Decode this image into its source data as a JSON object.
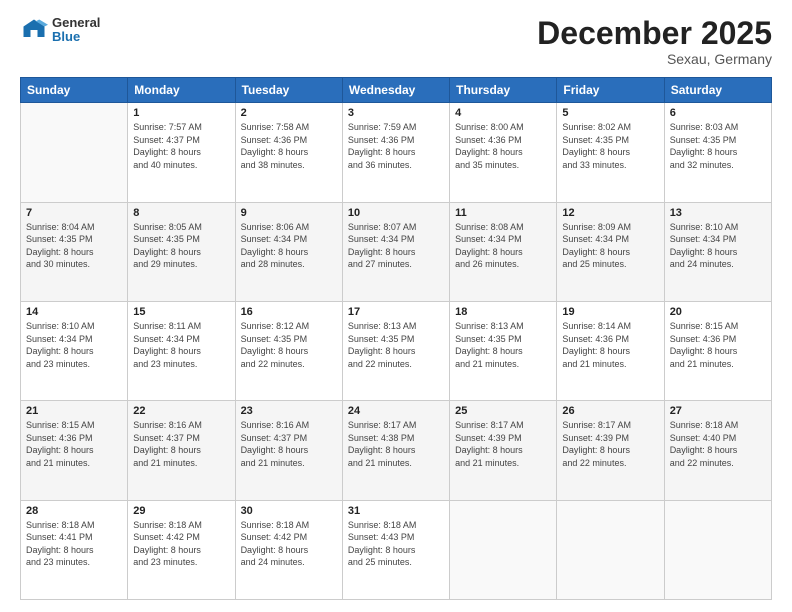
{
  "header": {
    "logo": {
      "general": "General",
      "blue": "Blue"
    },
    "title": "December 2025",
    "location": "Sexau, Germany"
  },
  "calendar": {
    "days_of_week": [
      "Sunday",
      "Monday",
      "Tuesday",
      "Wednesday",
      "Thursday",
      "Friday",
      "Saturday"
    ],
    "weeks": [
      [
        {
          "day": "",
          "info": ""
        },
        {
          "day": "1",
          "info": "Sunrise: 7:57 AM\nSunset: 4:37 PM\nDaylight: 8 hours\nand 40 minutes."
        },
        {
          "day": "2",
          "info": "Sunrise: 7:58 AM\nSunset: 4:36 PM\nDaylight: 8 hours\nand 38 minutes."
        },
        {
          "day": "3",
          "info": "Sunrise: 7:59 AM\nSunset: 4:36 PM\nDaylight: 8 hours\nand 36 minutes."
        },
        {
          "day": "4",
          "info": "Sunrise: 8:00 AM\nSunset: 4:36 PM\nDaylight: 8 hours\nand 35 minutes."
        },
        {
          "day": "5",
          "info": "Sunrise: 8:02 AM\nSunset: 4:35 PM\nDaylight: 8 hours\nand 33 minutes."
        },
        {
          "day": "6",
          "info": "Sunrise: 8:03 AM\nSunset: 4:35 PM\nDaylight: 8 hours\nand 32 minutes."
        }
      ],
      [
        {
          "day": "7",
          "info": "Sunrise: 8:04 AM\nSunset: 4:35 PM\nDaylight: 8 hours\nand 30 minutes."
        },
        {
          "day": "8",
          "info": "Sunrise: 8:05 AM\nSunset: 4:35 PM\nDaylight: 8 hours\nand 29 minutes."
        },
        {
          "day": "9",
          "info": "Sunrise: 8:06 AM\nSunset: 4:34 PM\nDaylight: 8 hours\nand 28 minutes."
        },
        {
          "day": "10",
          "info": "Sunrise: 8:07 AM\nSunset: 4:34 PM\nDaylight: 8 hours\nand 27 minutes."
        },
        {
          "day": "11",
          "info": "Sunrise: 8:08 AM\nSunset: 4:34 PM\nDaylight: 8 hours\nand 26 minutes."
        },
        {
          "day": "12",
          "info": "Sunrise: 8:09 AM\nSunset: 4:34 PM\nDaylight: 8 hours\nand 25 minutes."
        },
        {
          "day": "13",
          "info": "Sunrise: 8:10 AM\nSunset: 4:34 PM\nDaylight: 8 hours\nand 24 minutes."
        }
      ],
      [
        {
          "day": "14",
          "info": "Sunrise: 8:10 AM\nSunset: 4:34 PM\nDaylight: 8 hours\nand 23 minutes."
        },
        {
          "day": "15",
          "info": "Sunrise: 8:11 AM\nSunset: 4:34 PM\nDaylight: 8 hours\nand 23 minutes."
        },
        {
          "day": "16",
          "info": "Sunrise: 8:12 AM\nSunset: 4:35 PM\nDaylight: 8 hours\nand 22 minutes."
        },
        {
          "day": "17",
          "info": "Sunrise: 8:13 AM\nSunset: 4:35 PM\nDaylight: 8 hours\nand 22 minutes."
        },
        {
          "day": "18",
          "info": "Sunrise: 8:13 AM\nSunset: 4:35 PM\nDaylight: 8 hours\nand 21 minutes."
        },
        {
          "day": "19",
          "info": "Sunrise: 8:14 AM\nSunset: 4:36 PM\nDaylight: 8 hours\nand 21 minutes."
        },
        {
          "day": "20",
          "info": "Sunrise: 8:15 AM\nSunset: 4:36 PM\nDaylight: 8 hours\nand 21 minutes."
        }
      ],
      [
        {
          "day": "21",
          "info": "Sunrise: 8:15 AM\nSunset: 4:36 PM\nDaylight: 8 hours\nand 21 minutes."
        },
        {
          "day": "22",
          "info": "Sunrise: 8:16 AM\nSunset: 4:37 PM\nDaylight: 8 hours\nand 21 minutes."
        },
        {
          "day": "23",
          "info": "Sunrise: 8:16 AM\nSunset: 4:37 PM\nDaylight: 8 hours\nand 21 minutes."
        },
        {
          "day": "24",
          "info": "Sunrise: 8:17 AM\nSunset: 4:38 PM\nDaylight: 8 hours\nand 21 minutes."
        },
        {
          "day": "25",
          "info": "Sunrise: 8:17 AM\nSunset: 4:39 PM\nDaylight: 8 hours\nand 21 minutes."
        },
        {
          "day": "26",
          "info": "Sunrise: 8:17 AM\nSunset: 4:39 PM\nDaylight: 8 hours\nand 22 minutes."
        },
        {
          "day": "27",
          "info": "Sunrise: 8:18 AM\nSunset: 4:40 PM\nDaylight: 8 hours\nand 22 minutes."
        }
      ],
      [
        {
          "day": "28",
          "info": "Sunrise: 8:18 AM\nSunset: 4:41 PM\nDaylight: 8 hours\nand 23 minutes."
        },
        {
          "day": "29",
          "info": "Sunrise: 8:18 AM\nSunset: 4:42 PM\nDaylight: 8 hours\nand 23 minutes."
        },
        {
          "day": "30",
          "info": "Sunrise: 8:18 AM\nSunset: 4:42 PM\nDaylight: 8 hours\nand 24 minutes."
        },
        {
          "day": "31",
          "info": "Sunrise: 8:18 AM\nSunset: 4:43 PM\nDaylight: 8 hours\nand 25 minutes."
        },
        {
          "day": "",
          "info": ""
        },
        {
          "day": "",
          "info": ""
        },
        {
          "day": "",
          "info": ""
        }
      ]
    ]
  }
}
